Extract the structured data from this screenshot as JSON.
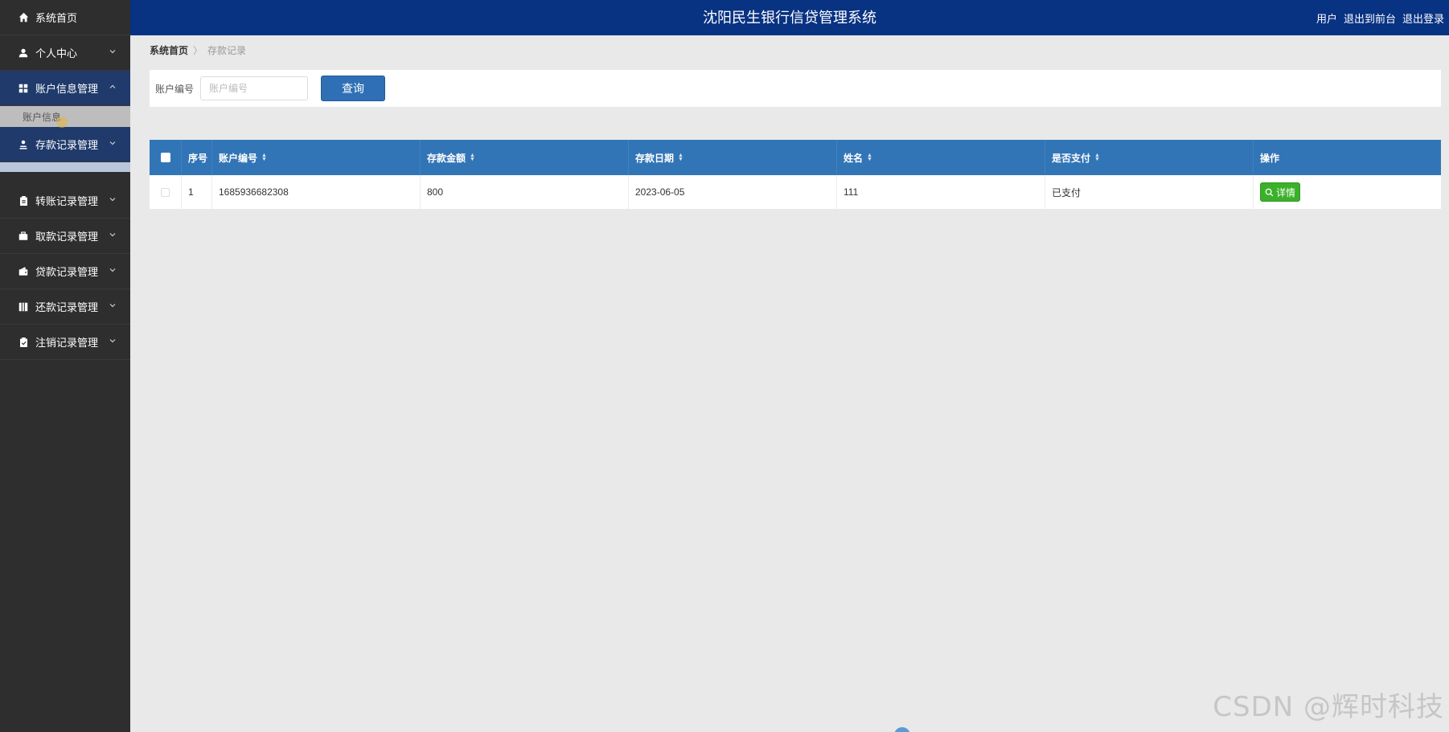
{
  "header": {
    "title": "沈阳民生银行信贷管理系统",
    "links": [
      "用户",
      "退出到前台",
      "退出登录"
    ]
  },
  "sidebar": {
    "items": [
      {
        "label": "系统首页",
        "icon": "home-icon"
      },
      {
        "label": "个人中心",
        "icon": "user-icon"
      },
      {
        "label": "账户信息管理",
        "icon": "grid-icon"
      },
      {
        "label": "存款记录管理",
        "icon": "user-upload-icon"
      },
      {
        "label": "转账记录管理",
        "icon": "clipboard-icon"
      },
      {
        "label": "取款记录管理",
        "icon": "briefcase-icon"
      },
      {
        "label": "贷款记录管理",
        "icon": "wallet-icon"
      },
      {
        "label": "还款记录管理",
        "icon": "book-icon"
      },
      {
        "label": "注销记录管理",
        "icon": "clipboard-check-icon"
      }
    ],
    "submenu": {
      "label": "账户信息"
    }
  },
  "breadcrumb": {
    "home": "系统首页",
    "separator": "〉",
    "current": "存款记录"
  },
  "search": {
    "label": "账户编号",
    "placeholder": "账户编号",
    "button": "查询"
  },
  "table": {
    "headers": [
      "序号",
      "账户编号",
      "存款金额",
      "存款日期",
      "姓名",
      "是否支付",
      "操作"
    ],
    "rows": [
      {
        "index": "1",
        "account": "1685936682308",
        "amount": "800",
        "date": "2023-06-05",
        "name": "111",
        "paid": "已支付",
        "action": "详情"
      }
    ]
  },
  "watermark": "CSDN @辉时科技",
  "colors": {
    "header_bg": "#083282",
    "sidebar_bg": "#2e2e2e",
    "table_header_bg": "#3275b6",
    "query_button": "#2f6fb5",
    "detail_button": "#3bb02a"
  }
}
